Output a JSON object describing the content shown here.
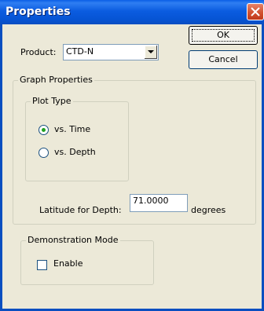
{
  "window": {
    "title": "Properties"
  },
  "product": {
    "label": "Product:",
    "selected": "CTD-N"
  },
  "buttons": {
    "ok": "OK",
    "cancel": "Cancel"
  },
  "graph_properties": {
    "title": "Graph Properties",
    "plot_type": {
      "title": "Plot Type",
      "options": [
        {
          "label": "vs. Time",
          "selected": true
        },
        {
          "label": "vs. Depth",
          "selected": false
        }
      ]
    },
    "latitude": {
      "label": "Latitude for Depth:",
      "value": "71.0000",
      "unit": "degrees"
    }
  },
  "demonstration_mode": {
    "title": "Demonstration Mode",
    "enable": {
      "label": "Enable",
      "checked": false
    }
  },
  "colors": {
    "titlebar": "#0a5fe6",
    "dialog_bg": "#ece9d8",
    "radio_dot": "#21a121"
  }
}
